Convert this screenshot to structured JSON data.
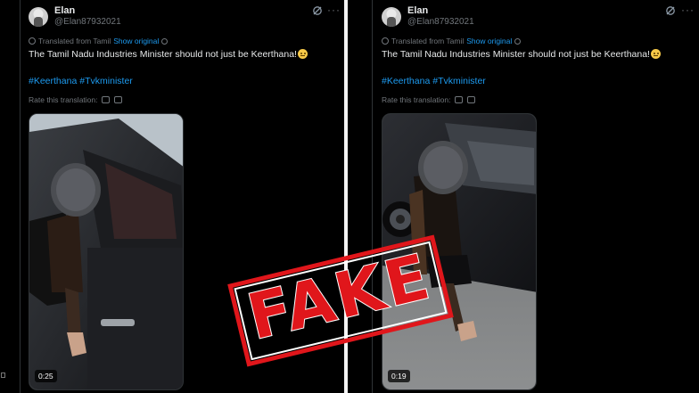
{
  "tweets": [
    {
      "name": "Elan",
      "handle": "@Elan87932021",
      "translated_from": "Translated from Tamil",
      "show_original": "Show original",
      "text": "The Tamil Nadu Industries Minister should not just be Keerthana!",
      "hashtags": [
        "#Keerthana",
        "#Tvkminister"
      ],
      "rate_label": "Rate this translation:",
      "video_duration": "0:25"
    },
    {
      "name": "Elan",
      "handle": "@Elan87932021",
      "translated_from": "Translated from Tamil",
      "show_original": "Show original",
      "text": "The Tamil Nadu Industries Minister should not just be Keerthana!",
      "hashtags": [
        "#Keerthana",
        "#Tvkminister"
      ],
      "rate_label": "Rate this translation:",
      "video_duration": "0:19"
    }
  ],
  "stamp": {
    "text": "FAKE",
    "color": "#e0161b"
  },
  "colors": {
    "background": "#000000",
    "link": "#1d9bf0",
    "muted": "#71767b",
    "text": "#e7e9ea"
  },
  "icons": [
    "grok-icon",
    "more-icon",
    "globe-icon",
    "settings-icon",
    "thumbs-up-icon",
    "thumbs-down-icon"
  ]
}
